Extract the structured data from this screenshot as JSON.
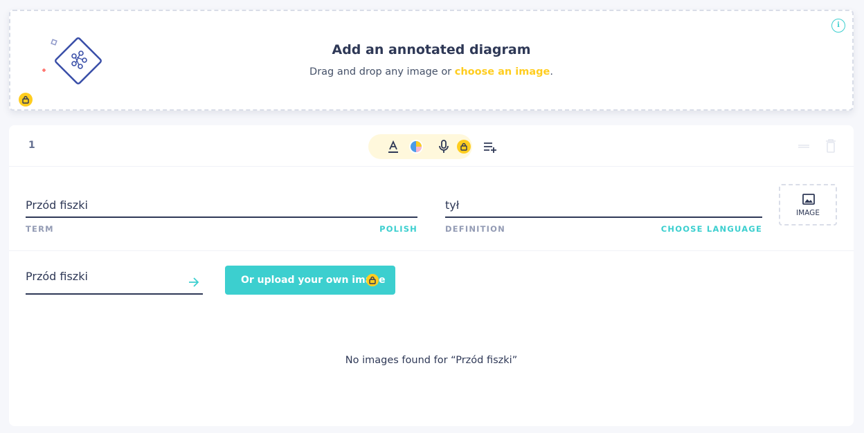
{
  "diagram": {
    "title": "Add an annotated diagram",
    "subtitle_prefix": "Drag and drop any image or ",
    "subtitle_link": "choose an image",
    "subtitle_suffix": ".",
    "info_icon": "i"
  },
  "card": {
    "number": "1",
    "toolbar": {
      "icons": [
        "text-format-icon",
        "color-picker-icon",
        "microphone-icon",
        "lock-icon",
        "add-list-icon"
      ]
    },
    "term": {
      "value": "Przód fiszki",
      "label": "TERM",
      "language": "POLISH"
    },
    "definition": {
      "value": "tył",
      "label": "DEFINITION",
      "language": "CHOOSE LANGUAGE"
    },
    "image_button": {
      "label": "IMAGE"
    },
    "image_search": {
      "value": "Przód fiszki",
      "upload_label": "Or upload your own image",
      "no_results": "No images found for “Przód fiszki”"
    }
  },
  "colors": {
    "accent_teal": "#3ccfcf",
    "accent_yellow": "#ffcd1f",
    "text_dark": "#2e3856",
    "label_gray": "#939bb4"
  }
}
